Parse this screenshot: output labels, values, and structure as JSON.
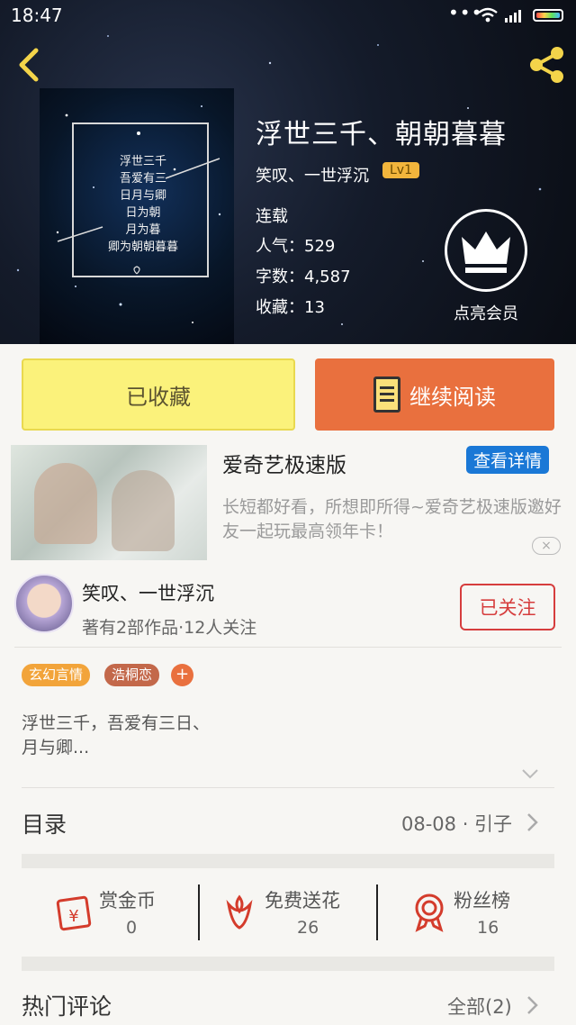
{
  "status_bar": {
    "time": "18:47",
    "dots": "•••"
  },
  "book": {
    "title": "浮世三千、朝朝暮暮",
    "author": "笑叹、一世浮沉",
    "level": "Lv1",
    "status": "连载",
    "popularity": "人气：529",
    "word_count": "字数：4,587",
    "favorites": "收藏：13",
    "cover_text": "浮世三千\n吾爱有三\n日月与卿\n日为朝\n月为暮\n卿为朝朝暮暮"
  },
  "vip": {
    "label": "点亮会员"
  },
  "actions": {
    "collected": "已收藏",
    "continue_reading": "继续阅读"
  },
  "ad": {
    "title": "爱奇艺极速版",
    "detail_button": "查看详情",
    "description": "长短都好看，所想即所得~爱奇艺极速版邀好友一起玩最高领年卡！",
    "close": "×"
  },
  "author_card": {
    "name": "笑叹、一世浮沉",
    "stats": "著有2部作品·12人关注",
    "follow_button": "已关注"
  },
  "tags": [
    "玄幻言情",
    "浩桐恋"
  ],
  "tag_add": "+",
  "summary": "浮世三千，吾爱有三日、月与卿...",
  "toc": {
    "label": "目录",
    "latest": "08-08 · 引子"
  },
  "stats": [
    {
      "label": "赏金币",
      "value": "0"
    },
    {
      "label": "免费送花",
      "value": "26"
    },
    {
      "label": "粉丝榜",
      "value": "16"
    }
  ],
  "comments": {
    "label": "热门评论",
    "all": "全部(2)"
  },
  "colors": {
    "accent": "#e9703e",
    "collected_bg": "#fbf27b",
    "follow_red": "#d63d3d",
    "link_blue": "#1a78d6"
  }
}
